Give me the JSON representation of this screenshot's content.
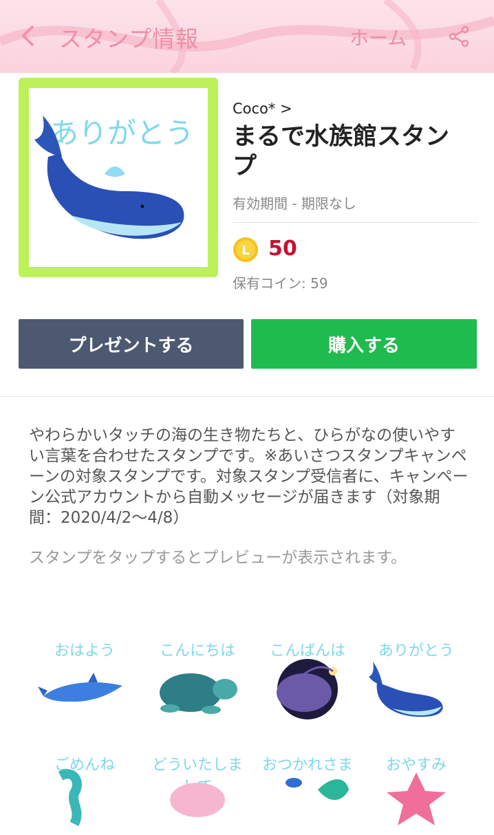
{
  "header": {
    "title": "スタンプ情報",
    "home_label": "ホーム"
  },
  "product": {
    "thumbnail_text": "ありがとう",
    "author": "Coco* >",
    "title": "まるで水族館スタンプ",
    "validity": "有効期間 - 期限なし",
    "coin_symbol": "L",
    "price": "50",
    "owned_coins": "保有コイン: 59"
  },
  "buttons": {
    "gift_label": "プレゼントする",
    "buy_label": "購入する"
  },
  "description": "やわらかいタッチの海の生き物たちと、ひらがなの使いやすい言葉を合わせたスタンプです。※あいさつスタンプキャンペーンの対象スタンプです。対象スタンプ受信者に、キャンペーン公式アカウントから自動メッセージが届きます（対象期間：2020/4/2〜4/8）",
  "preview_hint": "スタンプをタップするとプレビューが表示されます。",
  "stickers": [
    {
      "label": "おはよう",
      "icon": "dolphin-icon"
    },
    {
      "label": "こんにちは",
      "icon": "turtle-icon"
    },
    {
      "label": "こんばんは",
      "icon": "anglerfish-icon"
    },
    {
      "label": "ありがとう",
      "icon": "whale-icon"
    },
    {
      "label": "ごめんね",
      "icon": "seahorse-icon"
    },
    {
      "label": "どういたしまして",
      "icon": "axolotl-icon"
    },
    {
      "label": "おつかれさま",
      "icon": "fish-icon"
    },
    {
      "label": "おやすみ",
      "icon": "starfish-icon"
    }
  ],
  "colors": {
    "header_bg": "#fbd3de",
    "header_text": "#f08ea5",
    "thumb_frame": "#bdf159",
    "price": "#c8102e",
    "gift_button": "#4c5970",
    "buy_button": "#1fbb4f"
  }
}
